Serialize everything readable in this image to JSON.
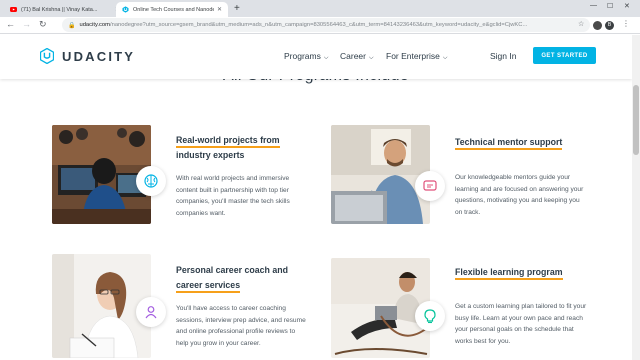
{
  "browser": {
    "tabs": [
      {
        "title": "(71) Bal Krishna || Vinay Kata...",
        "active": false,
        "favicon": "youtube-icon"
      },
      {
        "title": "Online Tech Courses and Nanode...",
        "active": true,
        "favicon": "udacity-icon"
      }
    ],
    "url_host": "udacity.com",
    "url_path": "/nanodegree?utm_source=gsem_brand&utm_medium=ads_n&utm_campaign=8305564463_c&utm_term=84143236463&utm_keyword=udacity_e&gclid=CjwKC...",
    "profile_initial": "B"
  },
  "header": {
    "logo_text": "UDACITY",
    "nav": [
      "Programs",
      "Career",
      "For Enterprise"
    ],
    "signin": "Sign In",
    "cta": "GET STARTED"
  },
  "section": {
    "title": "All Our Programs Include"
  },
  "features": [
    {
      "title_line1": "Real-world projects from",
      "title_line2": "industry experts",
      "description": [
        "With real world projects and immersive",
        "content built in partnership with top tier",
        "companies, you'll master the tech skills",
        "companies want."
      ],
      "icon": "brain-icon"
    },
    {
      "title_line1": "Technical mentor support",
      "title_line2": "",
      "description": [
        "Our knowledgeable mentors guide your",
        "learning and are focused on answering your",
        "questions, motivating you and keeping you",
        "on track."
      ],
      "icon": "chat-icon"
    },
    {
      "title_line1": "Personal career coach and",
      "title_line2": "career services",
      "description": [
        "You'll have access to career coaching",
        "sessions, interview prep advice, and resume",
        "and online professional profile reviews to",
        "help you grow in your career."
      ],
      "icon": "person-icon"
    },
    {
      "title_line1": "Flexible learning program",
      "title_line2": "",
      "description": [
        "Get a custom learning plan tailored to fit your",
        "busy life. Learn at your own pace and reach",
        "your personal goals on the schedule that",
        "works best for you."
      ],
      "icon": "lightbulb-icon"
    }
  ],
  "colors": {
    "accent": "#02b3e4",
    "underline": "#f6a01a",
    "text_dark": "#2e3d49",
    "text_body": "#525c65"
  }
}
